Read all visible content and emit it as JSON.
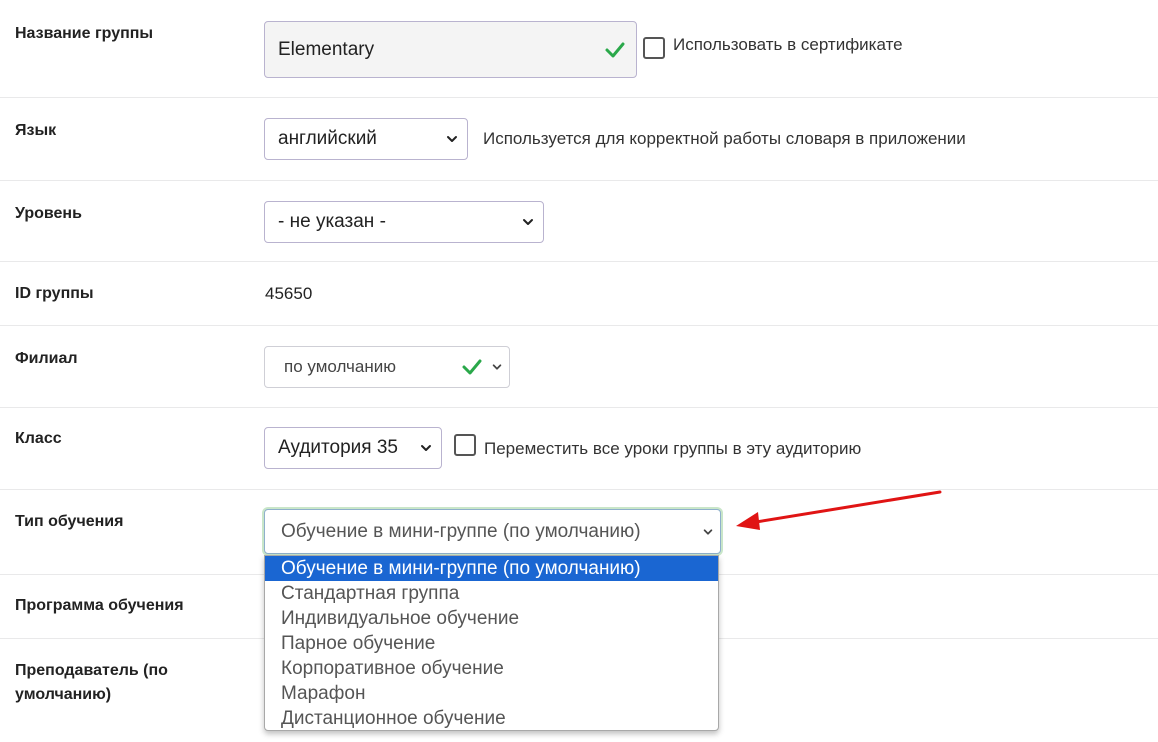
{
  "group_name": {
    "label": "Название группы",
    "value": "Elementary",
    "certificate_checkbox_label": "Использовать в сертификате",
    "certificate_checked": false
  },
  "language": {
    "label": "Язык",
    "selected": "английский",
    "hint": "Используется для корректной работы словаря в приложении"
  },
  "level": {
    "label": "Уровень",
    "selected": "- не указан -"
  },
  "group_id": {
    "label": "ID группы",
    "value": "45650"
  },
  "branch": {
    "label": "Филиал",
    "selected": "по умолчанию"
  },
  "classroom": {
    "label": "Класс",
    "selected": "Аудитория 35",
    "move_lessons_label": "Переместить все уроки группы в эту аудиторию",
    "move_lessons_checked": false
  },
  "training_type": {
    "label": "Тип обучения",
    "selected": "Обучение в мини-группе (по умолчанию)",
    "options": [
      "Обучение в мини-группе (по умолчанию)",
      "Стандартная группа",
      "Индивидуальное обучение",
      "Парное обучение",
      "Корпоративное обучение",
      "Марафон",
      "Дистанционное обучение"
    ],
    "highlighted_index": 0
  },
  "program": {
    "label": "Программа обучения"
  },
  "teacher": {
    "label": "Преподаватель (по умолчанию)"
  },
  "colors": {
    "accent_check": "#2aa84a",
    "highlight": "#1a66d2",
    "arrow": "#e01414"
  },
  "icons": {
    "valid": "check-icon",
    "select_caret": "chevron-down-icon",
    "annotation": "red-arrow-icon"
  }
}
